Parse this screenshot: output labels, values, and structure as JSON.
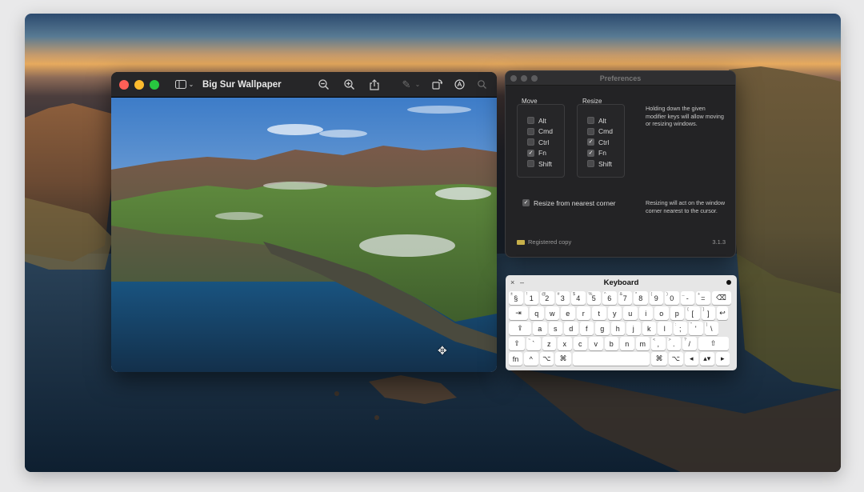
{
  "preview": {
    "title": "Big Sur Wallpaper",
    "icons": [
      "sidebar-icon",
      "chevron-down-icon",
      "zoom-out-icon",
      "zoom-in-icon",
      "share-icon",
      "markup-pen-icon",
      "chevron-down-icon",
      "rotate-icon",
      "annotate-icon",
      "search-icon"
    ]
  },
  "prefs": {
    "title": "Preferences",
    "move_label": "Move",
    "resize_label": "Resize",
    "move_options": [
      {
        "label": "Alt",
        "checked": false
      },
      {
        "label": "Cmd",
        "checked": false
      },
      {
        "label": "Ctrl",
        "checked": false
      },
      {
        "label": "Fn",
        "checked": true
      },
      {
        "label": "Shift",
        "checked": false
      }
    ],
    "resize_options": [
      {
        "label": "Alt",
        "checked": false
      },
      {
        "label": "Cmd",
        "checked": false
      },
      {
        "label": "Ctrl",
        "checked": true
      },
      {
        "label": "Fn",
        "checked": true
      },
      {
        "label": "Shift",
        "checked": false
      }
    ],
    "help_modifiers": "Holding down the given modifier keys will allow moving or resizing windows.",
    "nearest_corner_label": "Resize from nearest corner",
    "nearest_corner_checked": true,
    "help_corner": "Resizing will act on the window corner nearest to the cursor.",
    "registered": "Registered copy",
    "version": "3.1.3"
  },
  "keyboard": {
    "title": "Keyboard",
    "close": "×",
    "minimize": "–",
    "rows": [
      [
        [
          "§",
          "±"
        ],
        [
          "1",
          "!"
        ],
        [
          "2",
          "@"
        ],
        [
          "3",
          "#"
        ],
        [
          "4",
          "$"
        ],
        [
          "5",
          "%"
        ],
        [
          "6",
          "^"
        ],
        [
          "7",
          "&"
        ],
        [
          "8",
          "*"
        ],
        [
          "9",
          "("
        ],
        [
          "0",
          ")"
        ],
        [
          "-",
          "_"
        ],
        [
          "=",
          "+"
        ],
        [
          "⌫",
          ""
        ]
      ],
      [
        [
          "⇥",
          ""
        ],
        [
          "q",
          ""
        ],
        [
          "w",
          ""
        ],
        [
          "e",
          ""
        ],
        [
          "r",
          ""
        ],
        [
          "t",
          ""
        ],
        [
          "y",
          ""
        ],
        [
          "u",
          ""
        ],
        [
          "i",
          ""
        ],
        [
          "o",
          ""
        ],
        [
          "p",
          ""
        ],
        [
          "[",
          "{"
        ],
        [
          "]",
          "}"
        ],
        [
          "↩",
          ""
        ]
      ],
      [
        [
          "⇪",
          ""
        ],
        [
          "a",
          ""
        ],
        [
          "s",
          ""
        ],
        [
          "d",
          ""
        ],
        [
          "f",
          ""
        ],
        [
          "g",
          ""
        ],
        [
          "h",
          ""
        ],
        [
          "j",
          ""
        ],
        [
          "k",
          ""
        ],
        [
          "l",
          ""
        ],
        [
          ";",
          ":"
        ],
        [
          "'",
          "\""
        ],
        [
          "\\",
          "|"
        ]
      ],
      [
        [
          "⇧",
          ""
        ],
        [
          "`",
          "~"
        ],
        [
          "z",
          ""
        ],
        [
          "x",
          ""
        ],
        [
          "c",
          ""
        ],
        [
          "v",
          ""
        ],
        [
          "b",
          ""
        ],
        [
          "n",
          ""
        ],
        [
          "m",
          ""
        ],
        [
          ",",
          "<"
        ],
        [
          ".",
          ">"
        ],
        [
          "/",
          "?"
        ],
        [
          "⇧",
          ""
        ]
      ],
      [
        [
          "fn",
          ""
        ],
        [
          "^",
          ""
        ],
        [
          "⌥",
          ""
        ],
        [
          "⌘",
          ""
        ],
        [
          "",
          ""
        ],
        [
          "⌘",
          ""
        ],
        [
          "⌥",
          ""
        ],
        [
          "◂",
          ""
        ],
        [
          "▴▾",
          ""
        ],
        [
          "▸",
          ""
        ]
      ]
    ]
  },
  "colors": {
    "close": "#fe5f57",
    "minimize": "#febc2e",
    "zoom": "#28c840"
  }
}
